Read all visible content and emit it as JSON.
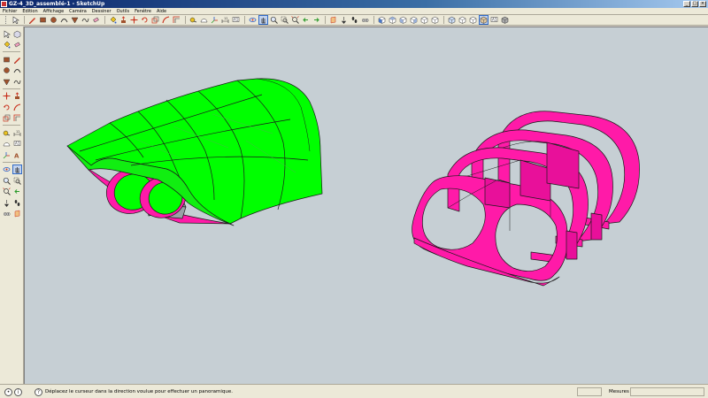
{
  "window": {
    "title": "GZ-4_3D_assemblé-1 - SketchUp",
    "controls": [
      "_",
      "□",
      "×"
    ]
  },
  "menu": {
    "items": [
      "Fichier",
      "Edition",
      "Affichage",
      "Caméra",
      "Dessiner",
      "Outils",
      "Fenêtre",
      "Aide"
    ]
  },
  "toolbar": {
    "icons": [
      "select-arrow-icon",
      "pencil-line-icon",
      "rectangle-icon",
      "circle-icon",
      "arc-icon",
      "polygon-icon",
      "freehand-icon",
      "eraser-icon",
      "paint-bucket-icon",
      "push-pull-icon",
      "move-icon",
      "rotate-icon",
      "scale-icon",
      "follow-me-icon",
      "offset-icon",
      "tape-measure-icon",
      "protractor-icon",
      "axes-icon",
      "dimension-icon",
      "text-icon",
      "orbit-icon",
      "pan-icon",
      "zoom-icon",
      "zoom-window-icon",
      "zoom-extents-icon",
      "previous-view-icon",
      "next-view-icon",
      "section-plane-icon",
      "camera-icon",
      "walk-icon",
      "look-around-icon"
    ],
    "view_icons": [
      "iso-view-icon",
      "top-view-icon",
      "front-view-icon",
      "right-view-icon",
      "back-view-icon",
      "left-view-icon"
    ],
    "style_icons": [
      "xray-style-icon",
      "wireframe-style-icon",
      "hidden-line-style-icon",
      "shaded-style-icon",
      "shaded-texture-style-icon",
      "monochrome-style-icon"
    ]
  },
  "lefttools": {
    "rows": [
      [
        "select-arrow-icon",
        "component-icon"
      ],
      [
        "paint-bucket-icon",
        "eraser-icon"
      ],
      [
        "rectangle-icon",
        "pencil-line-icon"
      ],
      [
        "circle-icon",
        "arc-icon"
      ],
      [
        "polygon-icon",
        "freehand-icon"
      ],
      [
        "move-icon",
        "push-pull-icon"
      ],
      [
        "rotate-icon",
        "follow-me-icon"
      ],
      [
        "scale-icon",
        "offset-icon"
      ],
      [
        "tape-measure-icon",
        "dimension-icon"
      ],
      [
        "protractor-icon",
        "text-icon"
      ],
      [
        "axes-icon",
        "3d-text-icon"
      ],
      [
        "orbit-icon",
        "pan-icon"
      ],
      [
        "zoom-icon",
        "zoom-window-icon"
      ],
      [
        "zoom-extents-icon",
        "previous-view-icon"
      ],
      [
        "position-camera-icon",
        "walk-icon"
      ],
      [
        "look-around-icon",
        "section-plane-icon"
      ]
    ]
  },
  "colors": {
    "viewport_bg": "#c6cfd4",
    "green_face": "#00ff00",
    "magenta_face": "#ff1aa8",
    "edge": "#1a1a1a"
  },
  "statusbar": {
    "message": "Déplacez le curseur dans la direction voulue pour effectuer un panoramique.",
    "measure_label": "Mesures",
    "measure_value": ""
  }
}
